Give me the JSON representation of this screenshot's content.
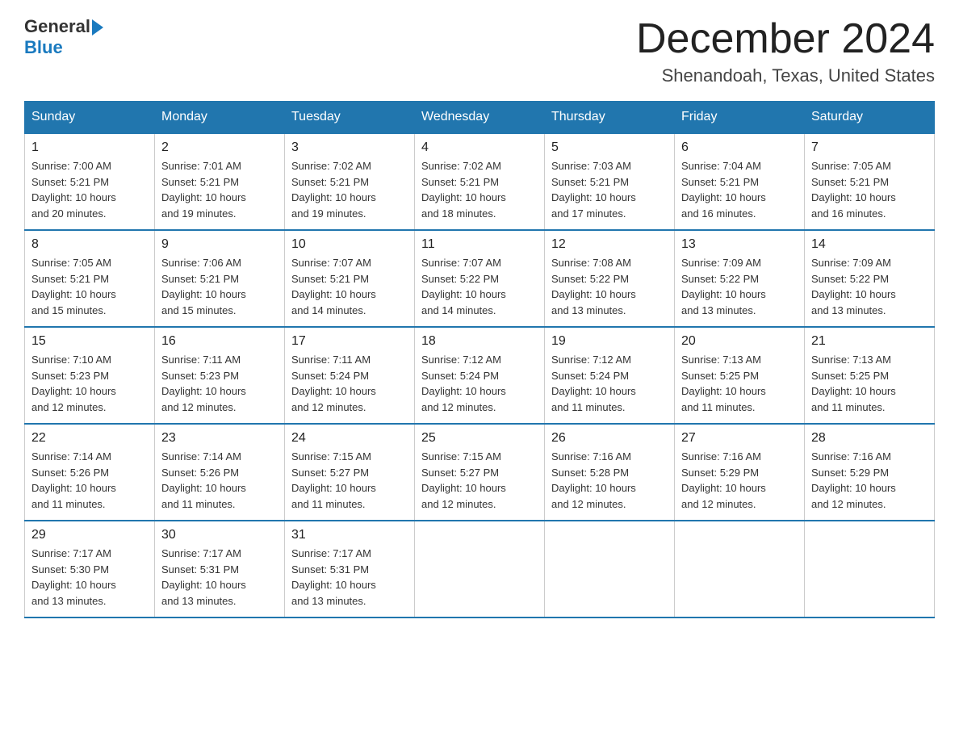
{
  "header": {
    "logo_general": "General",
    "logo_blue": "Blue",
    "title": "December 2024",
    "subtitle": "Shenandoah, Texas, United States"
  },
  "days_of_week": [
    "Sunday",
    "Monday",
    "Tuesday",
    "Wednesday",
    "Thursday",
    "Friday",
    "Saturday"
  ],
  "weeks": [
    [
      {
        "day": "1",
        "sunrise": "7:00 AM",
        "sunset": "5:21 PM",
        "daylight": "10 hours and 20 minutes."
      },
      {
        "day": "2",
        "sunrise": "7:01 AM",
        "sunset": "5:21 PM",
        "daylight": "10 hours and 19 minutes."
      },
      {
        "day": "3",
        "sunrise": "7:02 AM",
        "sunset": "5:21 PM",
        "daylight": "10 hours and 19 minutes."
      },
      {
        "day": "4",
        "sunrise": "7:02 AM",
        "sunset": "5:21 PM",
        "daylight": "10 hours and 18 minutes."
      },
      {
        "day": "5",
        "sunrise": "7:03 AM",
        "sunset": "5:21 PM",
        "daylight": "10 hours and 17 minutes."
      },
      {
        "day": "6",
        "sunrise": "7:04 AM",
        "sunset": "5:21 PM",
        "daylight": "10 hours and 16 minutes."
      },
      {
        "day": "7",
        "sunrise": "7:05 AM",
        "sunset": "5:21 PM",
        "daylight": "10 hours and 16 minutes."
      }
    ],
    [
      {
        "day": "8",
        "sunrise": "7:05 AM",
        "sunset": "5:21 PM",
        "daylight": "10 hours and 15 minutes."
      },
      {
        "day": "9",
        "sunrise": "7:06 AM",
        "sunset": "5:21 PM",
        "daylight": "10 hours and 15 minutes."
      },
      {
        "day": "10",
        "sunrise": "7:07 AM",
        "sunset": "5:21 PM",
        "daylight": "10 hours and 14 minutes."
      },
      {
        "day": "11",
        "sunrise": "7:07 AM",
        "sunset": "5:22 PM",
        "daylight": "10 hours and 14 minutes."
      },
      {
        "day": "12",
        "sunrise": "7:08 AM",
        "sunset": "5:22 PM",
        "daylight": "10 hours and 13 minutes."
      },
      {
        "day": "13",
        "sunrise": "7:09 AM",
        "sunset": "5:22 PM",
        "daylight": "10 hours and 13 minutes."
      },
      {
        "day": "14",
        "sunrise": "7:09 AM",
        "sunset": "5:22 PM",
        "daylight": "10 hours and 13 minutes."
      }
    ],
    [
      {
        "day": "15",
        "sunrise": "7:10 AM",
        "sunset": "5:23 PM",
        "daylight": "10 hours and 12 minutes."
      },
      {
        "day": "16",
        "sunrise": "7:11 AM",
        "sunset": "5:23 PM",
        "daylight": "10 hours and 12 minutes."
      },
      {
        "day": "17",
        "sunrise": "7:11 AM",
        "sunset": "5:24 PM",
        "daylight": "10 hours and 12 minutes."
      },
      {
        "day": "18",
        "sunrise": "7:12 AM",
        "sunset": "5:24 PM",
        "daylight": "10 hours and 12 minutes."
      },
      {
        "day": "19",
        "sunrise": "7:12 AM",
        "sunset": "5:24 PM",
        "daylight": "10 hours and 11 minutes."
      },
      {
        "day": "20",
        "sunrise": "7:13 AM",
        "sunset": "5:25 PM",
        "daylight": "10 hours and 11 minutes."
      },
      {
        "day": "21",
        "sunrise": "7:13 AM",
        "sunset": "5:25 PM",
        "daylight": "10 hours and 11 minutes."
      }
    ],
    [
      {
        "day": "22",
        "sunrise": "7:14 AM",
        "sunset": "5:26 PM",
        "daylight": "10 hours and 11 minutes."
      },
      {
        "day": "23",
        "sunrise": "7:14 AM",
        "sunset": "5:26 PM",
        "daylight": "10 hours and 11 minutes."
      },
      {
        "day": "24",
        "sunrise": "7:15 AM",
        "sunset": "5:27 PM",
        "daylight": "10 hours and 11 minutes."
      },
      {
        "day": "25",
        "sunrise": "7:15 AM",
        "sunset": "5:27 PM",
        "daylight": "10 hours and 12 minutes."
      },
      {
        "day": "26",
        "sunrise": "7:16 AM",
        "sunset": "5:28 PM",
        "daylight": "10 hours and 12 minutes."
      },
      {
        "day": "27",
        "sunrise": "7:16 AM",
        "sunset": "5:29 PM",
        "daylight": "10 hours and 12 minutes."
      },
      {
        "day": "28",
        "sunrise": "7:16 AM",
        "sunset": "5:29 PM",
        "daylight": "10 hours and 12 minutes."
      }
    ],
    [
      {
        "day": "29",
        "sunrise": "7:17 AM",
        "sunset": "5:30 PM",
        "daylight": "10 hours and 13 minutes."
      },
      {
        "day": "30",
        "sunrise": "7:17 AM",
        "sunset": "5:31 PM",
        "daylight": "10 hours and 13 minutes."
      },
      {
        "day": "31",
        "sunrise": "7:17 AM",
        "sunset": "5:31 PM",
        "daylight": "10 hours and 13 minutes."
      },
      null,
      null,
      null,
      null
    ]
  ],
  "labels": {
    "sunrise": "Sunrise:",
    "sunset": "Sunset:",
    "daylight": "Daylight:"
  }
}
